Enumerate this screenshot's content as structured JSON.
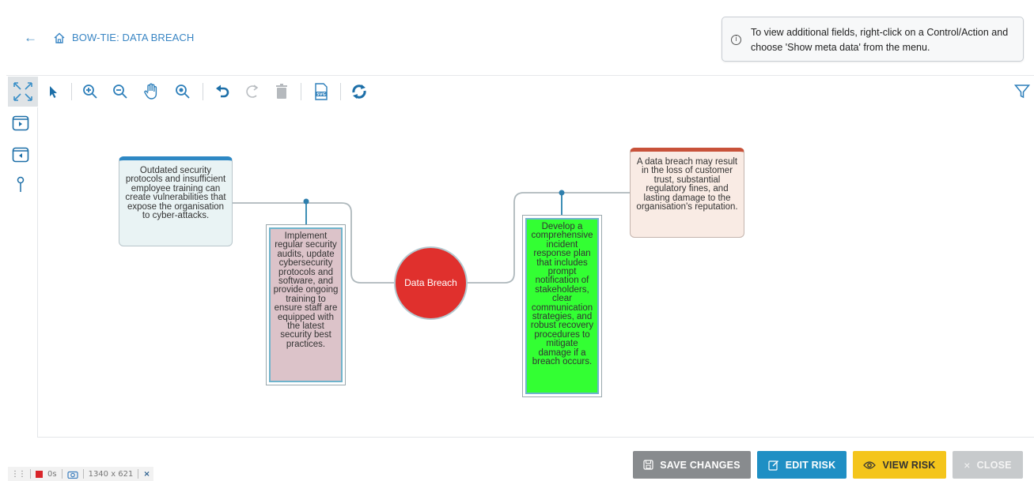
{
  "header": {
    "back_icon": "arrow-left-icon",
    "home_icon": "home-icon",
    "breadcrumb": "BOW-TIE: DATA BREACH"
  },
  "info": {
    "icon": "info-icon",
    "text": "To view additional fields, right-click on a Control/Action and choose 'Show meta data' from the menu."
  },
  "toolbar": {
    "tools": [
      "expand-icon",
      "pointer-icon",
      "zoom-in-icon",
      "zoom-out-icon",
      "pan-hand-icon",
      "zoom-fit-icon",
      "undo-icon",
      "redo-icon",
      "delete-icon",
      "export-svg-icon",
      "refresh-icon",
      "filter-icon"
    ],
    "svg_label": "SVG"
  },
  "rail": {
    "tools": [
      "collapse-right-icon",
      "collapse-left-icon",
      "pin-icon"
    ]
  },
  "diagram": {
    "cause": "Outdated security protocols and insufficient employee training can create vulnerabilities that expose the organisation to cyber-attacks.",
    "preventive_control": "Implement regular security audits, update cybersecurity protocols and software, and provide ongoing training to ensure staff are equipped with the latest security best practices.",
    "event": "Data Breach",
    "mitigating_control": "Develop a comprehensive incident response plan that includes prompt notification of stakeholders, clear communication strategies, and robust recovery procedures to mitigate damage if a breach occurs.",
    "consequence": "A data breach may result in the loss of customer trust, substantial regulatory fines, and lasting damage to the organisation's reputation.",
    "colors": {
      "event": "#e0302d",
      "preventive": "#dcc3c9",
      "mitigating": "#33ff33",
      "cause_top": "#2e88c4",
      "consequence_top": "#c8523a"
    }
  },
  "actions": {
    "save": "SAVE CHANGES",
    "edit": "EDIT RISK",
    "view": "VIEW RISK",
    "close": "CLOSE"
  },
  "recorder": {
    "time": "0s",
    "size": "1340 x 621",
    "close": "×"
  }
}
